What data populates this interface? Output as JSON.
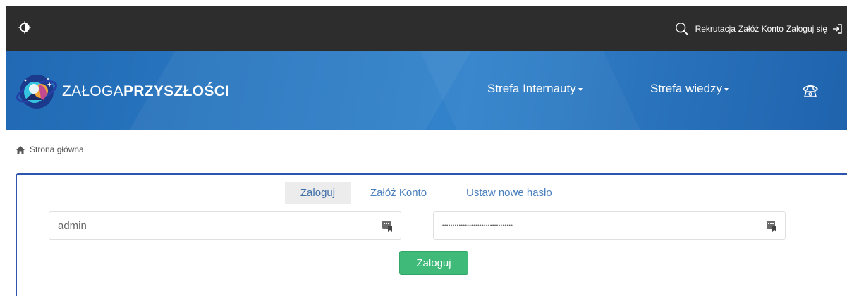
{
  "topbar": {
    "theme_toggle_icon": "half-circle-icon",
    "search_icon": "search-icon",
    "links": [
      "Rekrutacja",
      "Załóż Konto",
      "Zaloguj się"
    ],
    "login_icon": "sign-in-icon"
  },
  "brand": {
    "name_light": "ZAŁOGA",
    "name_bold": "PRZYSZŁOŚCI",
    "logo_icon": "astronaut-logo-icon"
  },
  "nav": {
    "items": [
      "Strefa Internauty",
      "Strefa wiedzy"
    ],
    "contact_icon": "phone-icon",
    "background": "#2a78c1"
  },
  "breadcrumb": {
    "home_icon": "home-icon",
    "label": "Strona główna"
  },
  "login": {
    "tabs": [
      "Zaloguj",
      "Załóż Konto",
      "Ustaw nowe hasło"
    ],
    "active_tab": "Zaloguj",
    "username_value": "admin",
    "password_value": "••••••••••••••••••••••••••••••••••",
    "keyboard_icon": "keyboard-icon",
    "submit_label": "Zaloguj",
    "submit_color": "#3fba78",
    "panel_border_color": "#2e55ae"
  }
}
